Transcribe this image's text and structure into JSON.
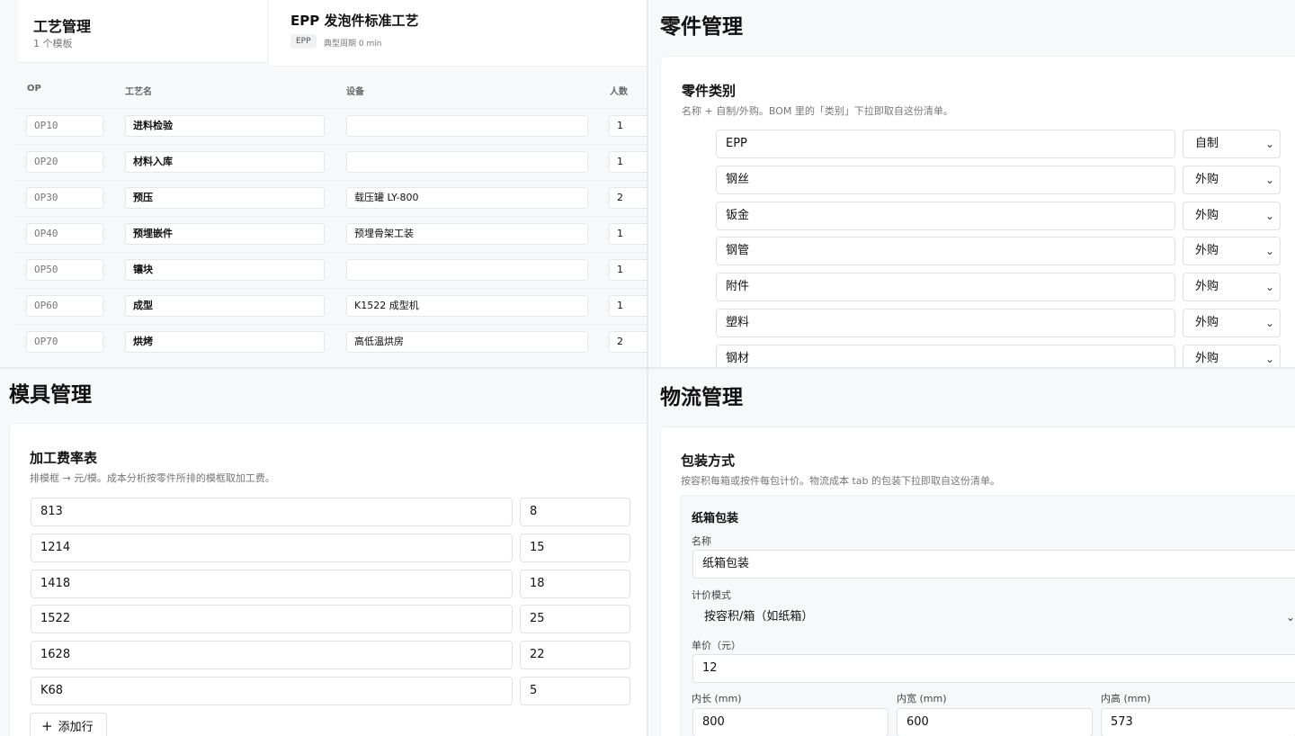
{
  "process": {
    "title": "工艺管理",
    "count": "1 个模板",
    "template_title": "EPP 发泡件标准工艺",
    "tag": "EPP",
    "cycle": "典型周期 0 min",
    "headers": {
      "op": "OP",
      "name": "工艺名",
      "equipment": "设备",
      "people": "人数"
    },
    "rows": [
      {
        "op": "OP10",
        "name": "进料检验",
        "equipment": "",
        "people": "1"
      },
      {
        "op": "OP20",
        "name": "材料入库",
        "equipment": "",
        "people": "1"
      },
      {
        "op": "OP30",
        "name": "预压",
        "equipment": "载压罐 LY-800",
        "people": "2"
      },
      {
        "op": "OP40",
        "name": "预埋嵌件",
        "equipment": "预埋骨架工装",
        "people": "1"
      },
      {
        "op": "OP50",
        "name": "镶块",
        "equipment": "",
        "people": "1"
      },
      {
        "op": "OP60",
        "name": "成型",
        "equipment": "K1522 成型机",
        "people": "1"
      },
      {
        "op": "OP70",
        "name": "烘烤",
        "equipment": "高低温烘房",
        "people": "2"
      }
    ]
  },
  "parts": {
    "title": "零件管理",
    "card_title": "零件类别",
    "card_sub": "名称 + 自制/外购。BOM 里的「类别」下拉即取自这份清单。",
    "rows": [
      {
        "name": "EPP",
        "source": "自制"
      },
      {
        "name": "钢丝",
        "source": "外购"
      },
      {
        "name": "钣金",
        "source": "外购"
      },
      {
        "name": "钢管",
        "source": "外购"
      },
      {
        "name": "附件",
        "source": "外购"
      },
      {
        "name": "塑料",
        "source": "外购"
      },
      {
        "name": "钢材",
        "source": "外购"
      }
    ]
  },
  "molds": {
    "title": "模具管理",
    "card_title": "加工费率表",
    "card_sub": "排模框 → 元/模。成本分析按零件所排的模框取加工费。",
    "rows": [
      {
        "frame": "813",
        "rate": "8"
      },
      {
        "frame": "1214",
        "rate": "15"
      },
      {
        "frame": "1418",
        "rate": "18"
      },
      {
        "frame": "1522",
        "rate": "25"
      },
      {
        "frame": "1628",
        "rate": "22"
      },
      {
        "frame": "K68",
        "rate": "5"
      }
    ],
    "add_label": "添加行"
  },
  "logistics": {
    "title": "物流管理",
    "card_title": "包装方式",
    "card_sub": "按容积每箱或按件每包计价。物流成本 tab 的包装下拉即取自这份清单。",
    "pack_title": "纸箱包装",
    "name_label": "名称",
    "name_value": "纸箱包装",
    "mode_label": "计价模式",
    "mode_value": "按容积/箱（如纸箱）",
    "price_label": "单价（元）",
    "price_value": "12",
    "len_label": "内长 (mm)",
    "len_value": "800",
    "wid_label": "内宽 (mm)",
    "wid_value": "600",
    "hei_label": "内高 (mm)",
    "hei_value": "573"
  }
}
